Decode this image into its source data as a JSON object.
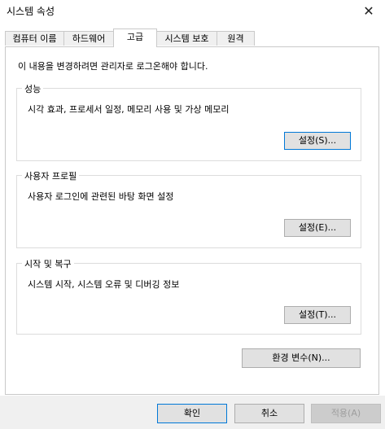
{
  "window": {
    "title": "시스템 속성",
    "close_glyph": "✕",
    "close_icon": "close-icon"
  },
  "tabs": [
    {
      "label": "컴퓨터 이름",
      "active": false
    },
    {
      "label": "하드웨어",
      "active": false
    },
    {
      "label": "고급",
      "active": true
    },
    {
      "label": "시스템 보호",
      "active": false
    },
    {
      "label": "원격",
      "active": false
    }
  ],
  "main": {
    "admin_note": "이 내용을 변경하려면 관리자로 로그온해야 합니다.",
    "groups": {
      "performance": {
        "title": "성능",
        "description": "시각 효과, 프로세서 일정, 메모리 사용 및 가상 메모리",
        "button": "설정(S)..."
      },
      "user_profiles": {
        "title": "사용자 프로필",
        "description": "사용자 로그인에 관련된 바탕 화면 설정",
        "button": "설정(E)..."
      },
      "startup_recovery": {
        "title": "시작 및 복구",
        "description": "시스템 시작, 시스템 오류 및 디버깅 정보",
        "button": "설정(T)..."
      }
    },
    "env_button": "환경 변수(N)..."
  },
  "footer": {
    "ok": "확인",
    "cancel": "취소",
    "apply": "적용(A)",
    "apply_disabled": true
  },
  "colors": {
    "focus_border": "#0078d7",
    "button_bg": "#e1e1e1",
    "footer_bg": "#f0f0f0"
  }
}
